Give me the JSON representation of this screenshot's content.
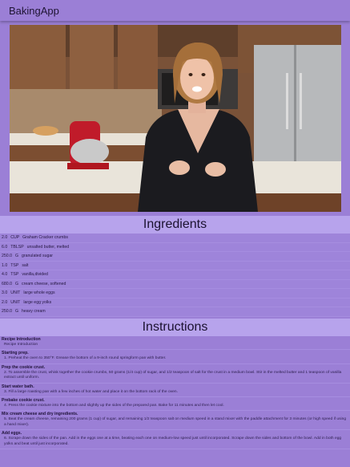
{
  "app": {
    "title": "BakingApp"
  },
  "ingredients": {
    "heading": "Ingredients",
    "items": [
      {
        "quantity": "2.0",
        "measure": "CUP",
        "name": "Graham Cracker crumbs"
      },
      {
        "quantity": "6.0",
        "measure": "TBLSP",
        "name": "unsalted butter, melted"
      },
      {
        "quantity": "250.0",
        "measure": "G",
        "name": "granulated sugar"
      },
      {
        "quantity": "1.0",
        "measure": "TSP",
        "name": "salt"
      },
      {
        "quantity": "4.0",
        "measure": "TSP",
        "name": "vanilla,divided"
      },
      {
        "quantity": "680.0",
        "measure": "G",
        "name": "cream cheese, softened"
      },
      {
        "quantity": "3.0",
        "measure": "UNIT",
        "name": "large whole eggs"
      },
      {
        "quantity": "2.0",
        "measure": "UNIT",
        "name": "large egg yolks"
      },
      {
        "quantity": "250.0",
        "measure": "G",
        "name": "heavy cream"
      }
    ]
  },
  "instructions": {
    "heading": "Instructions",
    "steps": [
      {
        "title": "Recipe Introduction",
        "desc": "Recipe Introduction"
      },
      {
        "title": "Starting prep.",
        "desc": "1. Preheat the oven to 350°F. Grease the bottom of a 9-inch round springform pan with butter."
      },
      {
        "title": "Prep the cookie crust.",
        "desc": "2. To assemble the crust, whisk together the cookie crumbs, 50 grams (1/4 cup) of sugar, and 1/2 teaspoon of salt for the crust in a medium bowl. Stir in the melted butter and 1 teaspoon of vanilla extract until uniform."
      },
      {
        "title": "Start water bath.",
        "desc": "3. Fill a large roasting pan with a few inches of hot water and place it on the bottom rack of the oven."
      },
      {
        "title": "Prebake cookie crust.",
        "desc": "4. Press the cookie mixture into the bottom and slightly up the sides of the prepared pan. Bake for 11 minutes and then let cool."
      },
      {
        "title": "Mix cream cheese and dry ingredients.",
        "desc": "5. Beat the cream cheese, remaining 200 grams (1 cup) of sugar, and remaining 1/2 teaspoon salt on medium speed in a stand mixer with the paddle attachment for 3 minutes (or high speed if using a hand mixer)."
      },
      {
        "title": "Add eggs.",
        "desc": "6. Scrape down the sides of the pan. Add in the eggs one at a time, beating each one on medium-low speed just until incorporated. Scrape down the sides and bottom of the bowl. Add in both egg yolks and beat until just incorporated."
      }
    ]
  },
  "video": {
    "description_icon": "video-player-icon"
  }
}
